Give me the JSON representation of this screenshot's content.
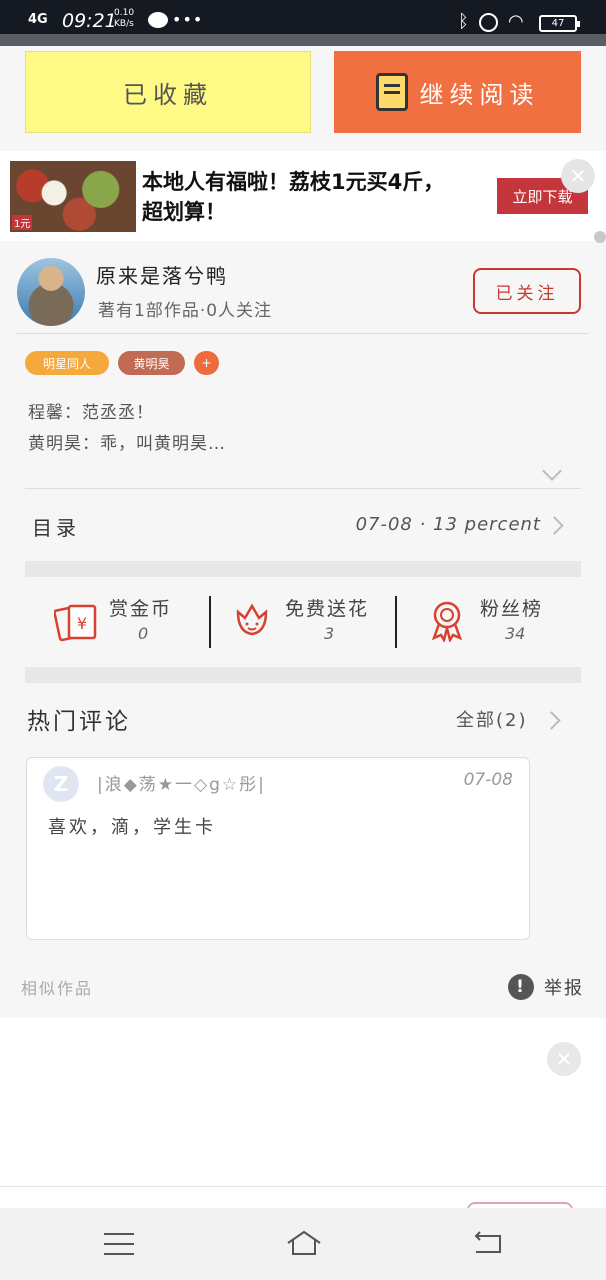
{
  "status_bar": {
    "network": "4G",
    "time": "09:21",
    "speed_value": "0.10",
    "speed_unit": "KB/s",
    "battery": "47"
  },
  "actions": {
    "favorite_label": "已收藏",
    "continue_label": "继续阅读"
  },
  "ad": {
    "image_tag": "1元",
    "text": "本地人有福啦！荔枝1元买4斤，超划算！",
    "download_label": "立即下载",
    "close_glyph": "✕"
  },
  "author": {
    "name": "原来是落兮鸭",
    "meta": "著有1部作品·0人关注",
    "follow_label": "已关注"
  },
  "tags": [
    {
      "label": "明星同人",
      "color": "#f5a93c"
    },
    {
      "label": "黄明昊",
      "color": "#c26a52"
    },
    {
      "label": "+",
      "color": "#ee6b3d"
    }
  ],
  "intro": {
    "line1": "程馨：范丞丞！",
    "line2": "黄明昊：乖，叫黄明昊…"
  },
  "catalog": {
    "label": "目录",
    "status": "07-08 · 13 percent"
  },
  "stats": [
    {
      "label": "赏金币",
      "value": "0",
      "icon": "red-envelope-icon"
    },
    {
      "label": "免费送花",
      "value": "3",
      "icon": "flower-icon"
    },
    {
      "label": "粉丝榜",
      "value": "34",
      "icon": "medal-icon"
    }
  ],
  "comments": {
    "title": "热门评论",
    "all_label": "全部(2)",
    "items": [
      {
        "user": "|浪◆荡★一◇g☆彤|",
        "date": "07-08",
        "text": "喜欢，滴，学生卡",
        "avatar_glyph": "Z"
      }
    ]
  },
  "footer": {
    "similar": "相似作品",
    "report": "举报",
    "report_glyph": "!"
  },
  "colors": {
    "accent": "#f07042",
    "favorite_bg": "#fff985",
    "follow": "#c9382e",
    "stat_icon": "#d8402f"
  }
}
